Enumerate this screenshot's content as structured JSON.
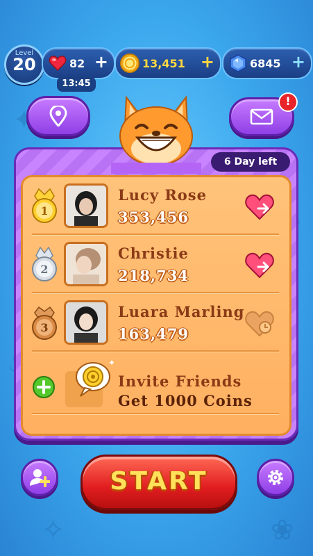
{
  "hud": {
    "level_label": "Level",
    "level": "20",
    "lives": "82",
    "lives_timer": "13:45",
    "coins": "13,451",
    "gems": "6845",
    "plus": "+",
    "mail_alert": "!"
  },
  "leaderboard": {
    "days_left": "6 Day left",
    "players": [
      {
        "rank": "1",
        "name": "Lucy  Rose",
        "score": "353,456",
        "medal": "gold-medal-icon",
        "action": "send-heart-icon"
      },
      {
        "rank": "2",
        "name": "Christie",
        "score": "218,734",
        "medal": "silver-medal-icon",
        "action": "send-heart-icon"
      },
      {
        "rank": "3",
        "name": "Luara  Marling",
        "score": "163,479",
        "medal": "bronze-medal-icon",
        "action": "heart-cooldown-icon"
      }
    ],
    "invite": {
      "title": "Invite  Friends",
      "reward": "Get  1000 Coins"
    }
  },
  "start_label": "START",
  "colors": {
    "accent_purple": "#a45cf0",
    "start_red": "#e11d20",
    "panel_orange": "#ffb868"
  }
}
